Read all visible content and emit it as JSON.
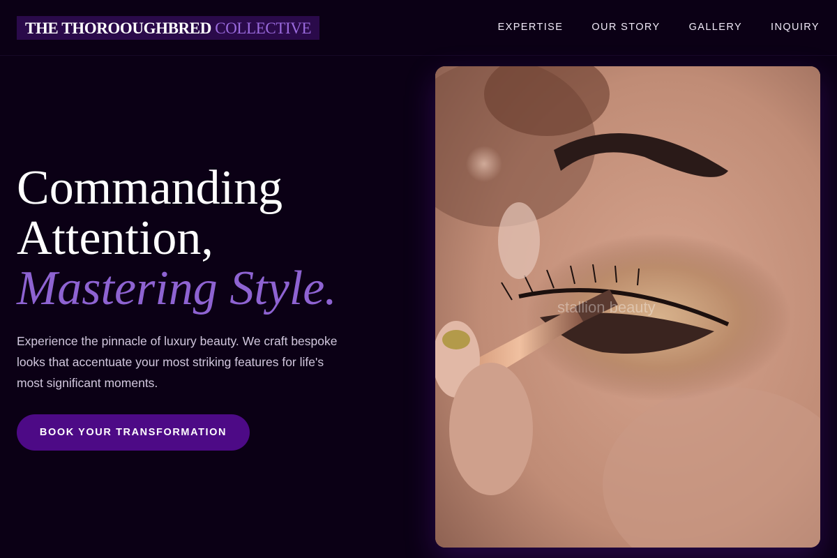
{
  "header": {
    "logo_main": "THE THOROOUGHBRED",
    "logo_accent": "COLLECTIVE",
    "nav": [
      {
        "label": "EXPERTISE"
      },
      {
        "label": "OUR STORY"
      },
      {
        "label": "GALLERY"
      },
      {
        "label": "INQUIRY"
      }
    ]
  },
  "hero": {
    "title_line1": "Commanding",
    "title_line2": "Attention,",
    "title_accent": "Mastering Style.",
    "description": "Experience the pinnacle of luxury beauty. We craft bespoke looks that accentuate your most striking features for life's most significant moments.",
    "cta_label": "BOOK YOUR TRANSFORMATION",
    "image_watermark": "stallion beauty"
  },
  "colors": {
    "background": "#0b0015",
    "accent": "#8e63d2",
    "button": "#4d0a86"
  }
}
